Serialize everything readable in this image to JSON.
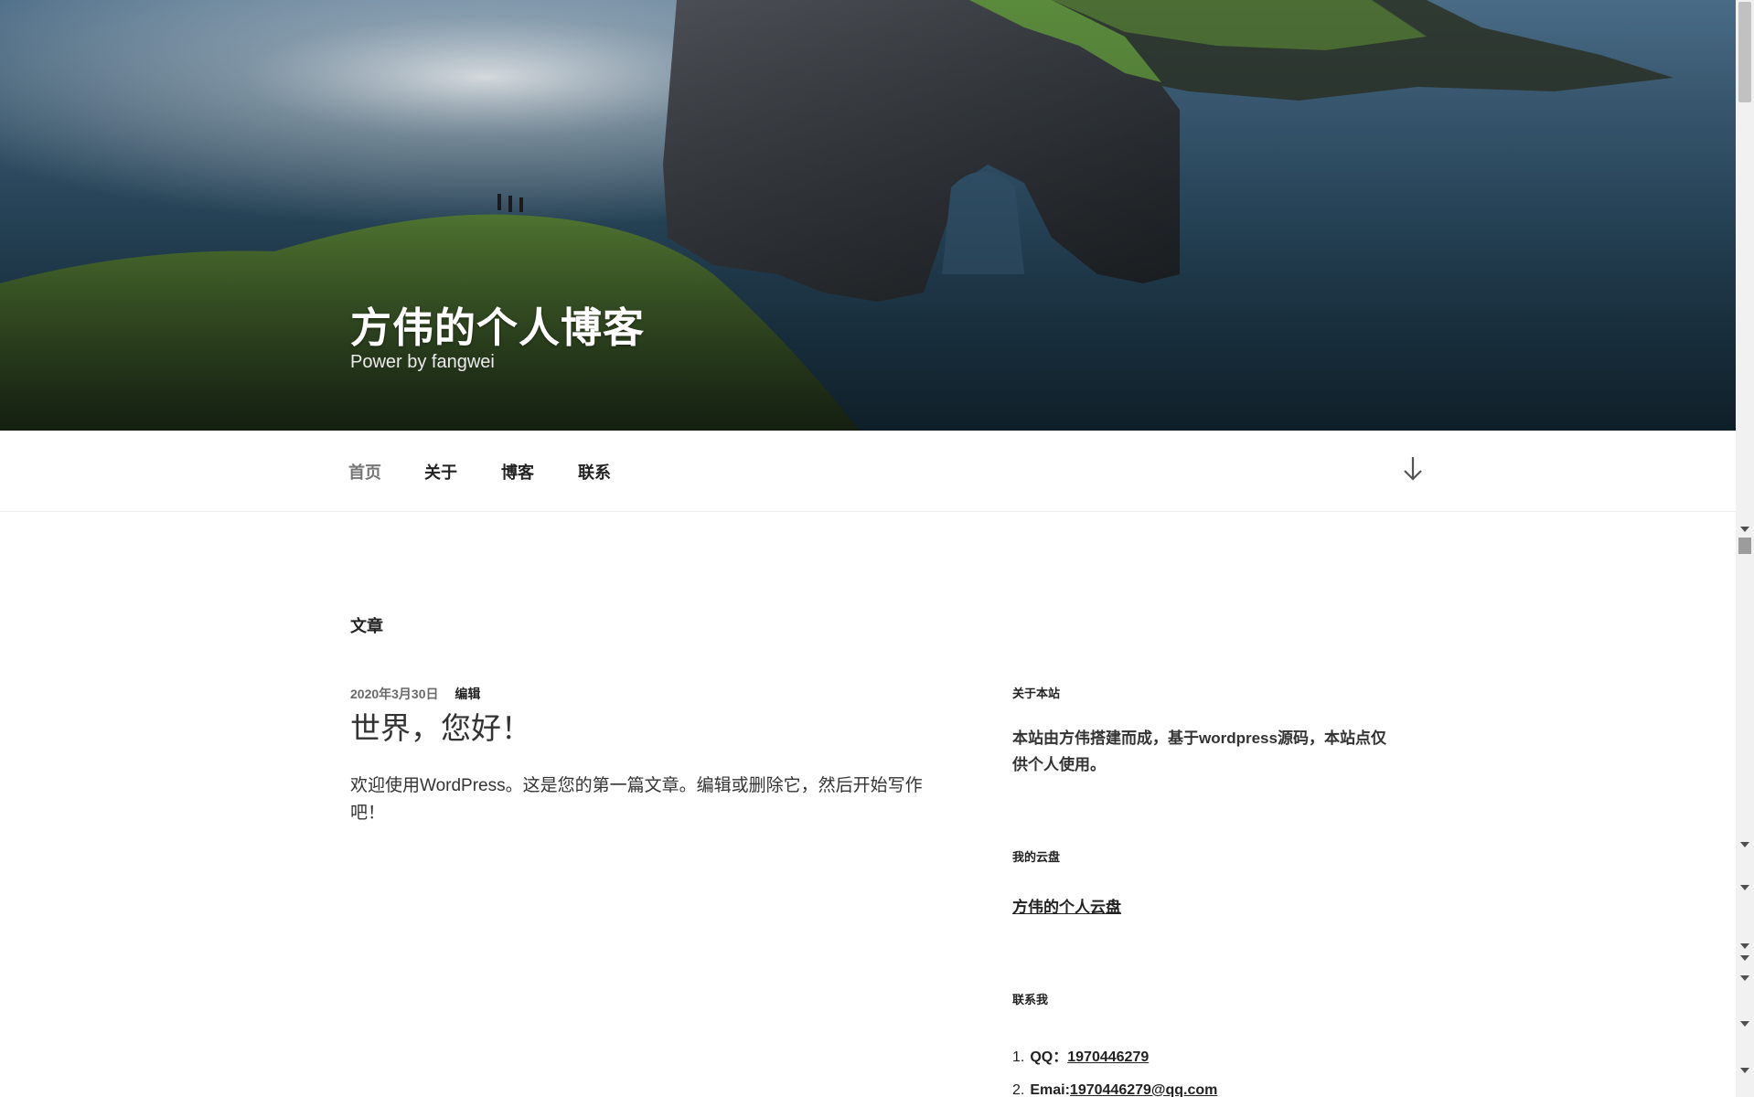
{
  "header": {
    "site_title": "方伟的个人博客",
    "site_description": "Power by fangwei"
  },
  "nav": {
    "items": [
      {
        "label": "首页",
        "current": true
      },
      {
        "label": "关于",
        "current": false
      },
      {
        "label": "博客",
        "current": false
      },
      {
        "label": "联系",
        "current": false
      }
    ],
    "scroll_icon": "arrow-down-icon"
  },
  "main": {
    "page_heading": "文章",
    "post": {
      "date": "2020年3月30日",
      "edit_label": "编辑",
      "title": "世界，您好！",
      "content": "欢迎使用WordPress。这是您的第一篇文章。编辑或删除它，然后开始写作吧！"
    }
  },
  "sidebar": {
    "about": {
      "title": "关于本站",
      "text": "本站由方伟搭建而成，基于wordpress源码，本站点仅供个人使用。"
    },
    "cloud": {
      "title": "我的云盘",
      "link": "方伟的个人云盘"
    },
    "contact": {
      "title": "联系我",
      "items": [
        {
          "num": "1.",
          "label": "QQ：",
          "value": "1970446279"
        },
        {
          "num": "2.",
          "label": "Emai:",
          "value": "1970446279@qq.com"
        }
      ]
    }
  },
  "colors": {
    "nav_current": "#767676",
    "text_dark": "#222222",
    "header_sea": "#2a4a66"
  }
}
